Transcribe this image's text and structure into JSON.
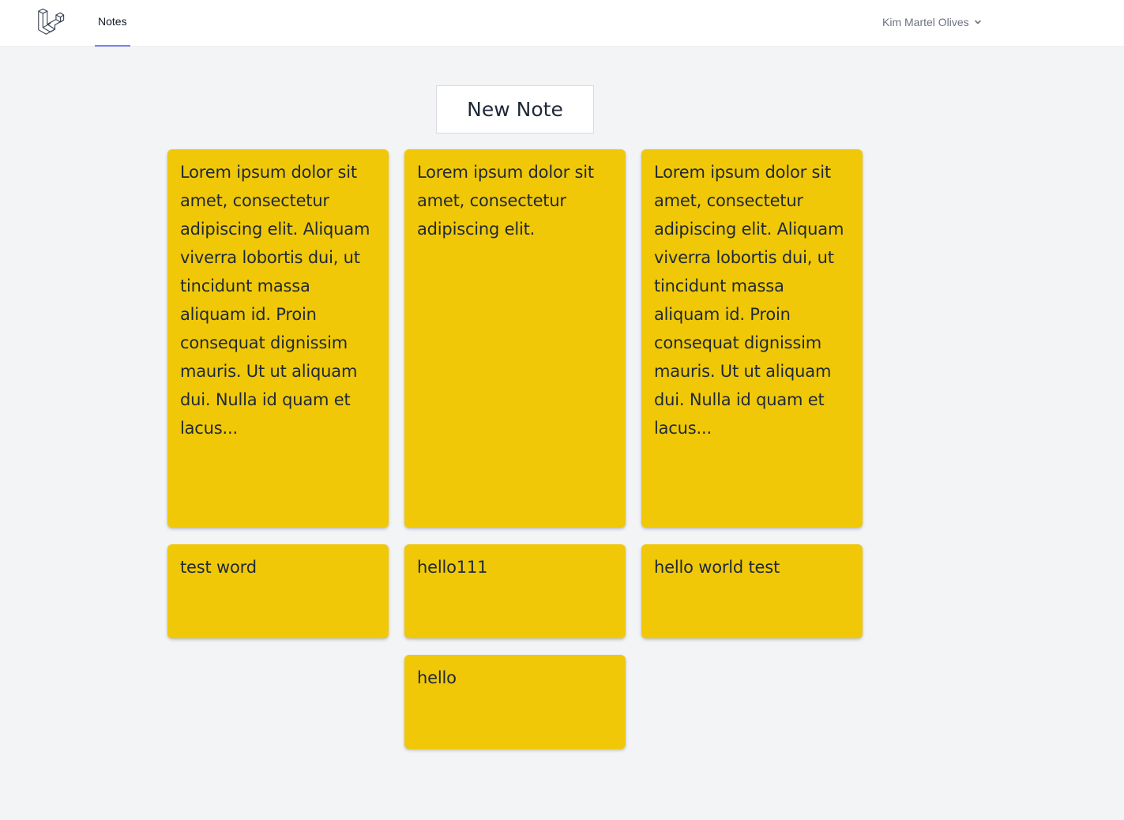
{
  "nav": {
    "logo_icon": "laravel-logo-icon",
    "notes_label": "Notes",
    "active_color": "#7c83e8",
    "user_name": "Kim Martel Olives",
    "user_chevron_icon": "chevron-down-icon"
  },
  "actions": {
    "new_note_label": "New Note"
  },
  "colors": {
    "note_background": "#f0c808",
    "page_background": "#f3f4f6"
  },
  "notes": [
    {
      "text": "Lorem ipsum dolor sit amet, consectetur adipiscing elit. Aliquam viverra lobortis dui, ut tincidunt massa aliquam id. Proin consequat dignissim mauris. Ut ut aliquam dui. Nulla id quam et lacus..."
    },
    {
      "text": "Lorem ipsum dolor sit amet, consectetur adipiscing elit."
    },
    {
      "text": "Lorem ipsum dolor sit amet, consectetur adipiscing elit. Aliquam viverra lobortis dui, ut tincidunt massa aliquam id. Proin consequat dignissim mauris. Ut ut aliquam dui. Nulla id quam et lacus..."
    },
    {
      "text": "test word"
    },
    {
      "text": "hello111"
    },
    {
      "text": "hello world test"
    },
    {
      "text": "hello"
    }
  ]
}
